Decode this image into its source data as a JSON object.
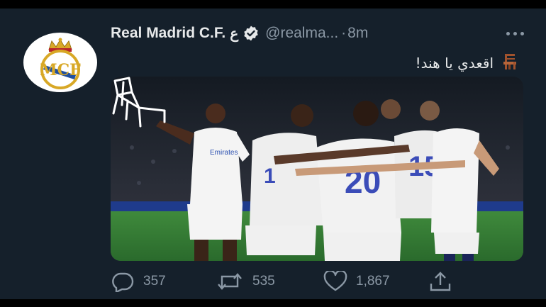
{
  "tweet": {
    "author_name": "Real Madrid C.F.",
    "author_name_extra": "ع",
    "handle": "@realma...",
    "separator": "·",
    "time": "8m",
    "text": "اقعدي يا هند!",
    "emoji_icon": "chair-icon",
    "avatar_icon": "real-madrid-crest-icon",
    "media_overlay_icon": "chair-sketch-icon"
  },
  "actions": {
    "reply": {
      "icon": "reply-icon",
      "count": "357"
    },
    "retweet": {
      "icon": "retweet-icon",
      "count": "535"
    },
    "like": {
      "icon": "heart-icon",
      "count": "1,867"
    },
    "share": {
      "icon": "share-icon"
    }
  },
  "colors": {
    "background": "#15202b",
    "text": "#e7e9ea",
    "secondary": "#8b98a5",
    "crest_gold": "#d8a826",
    "crest_blue": "#1f4fa0"
  }
}
